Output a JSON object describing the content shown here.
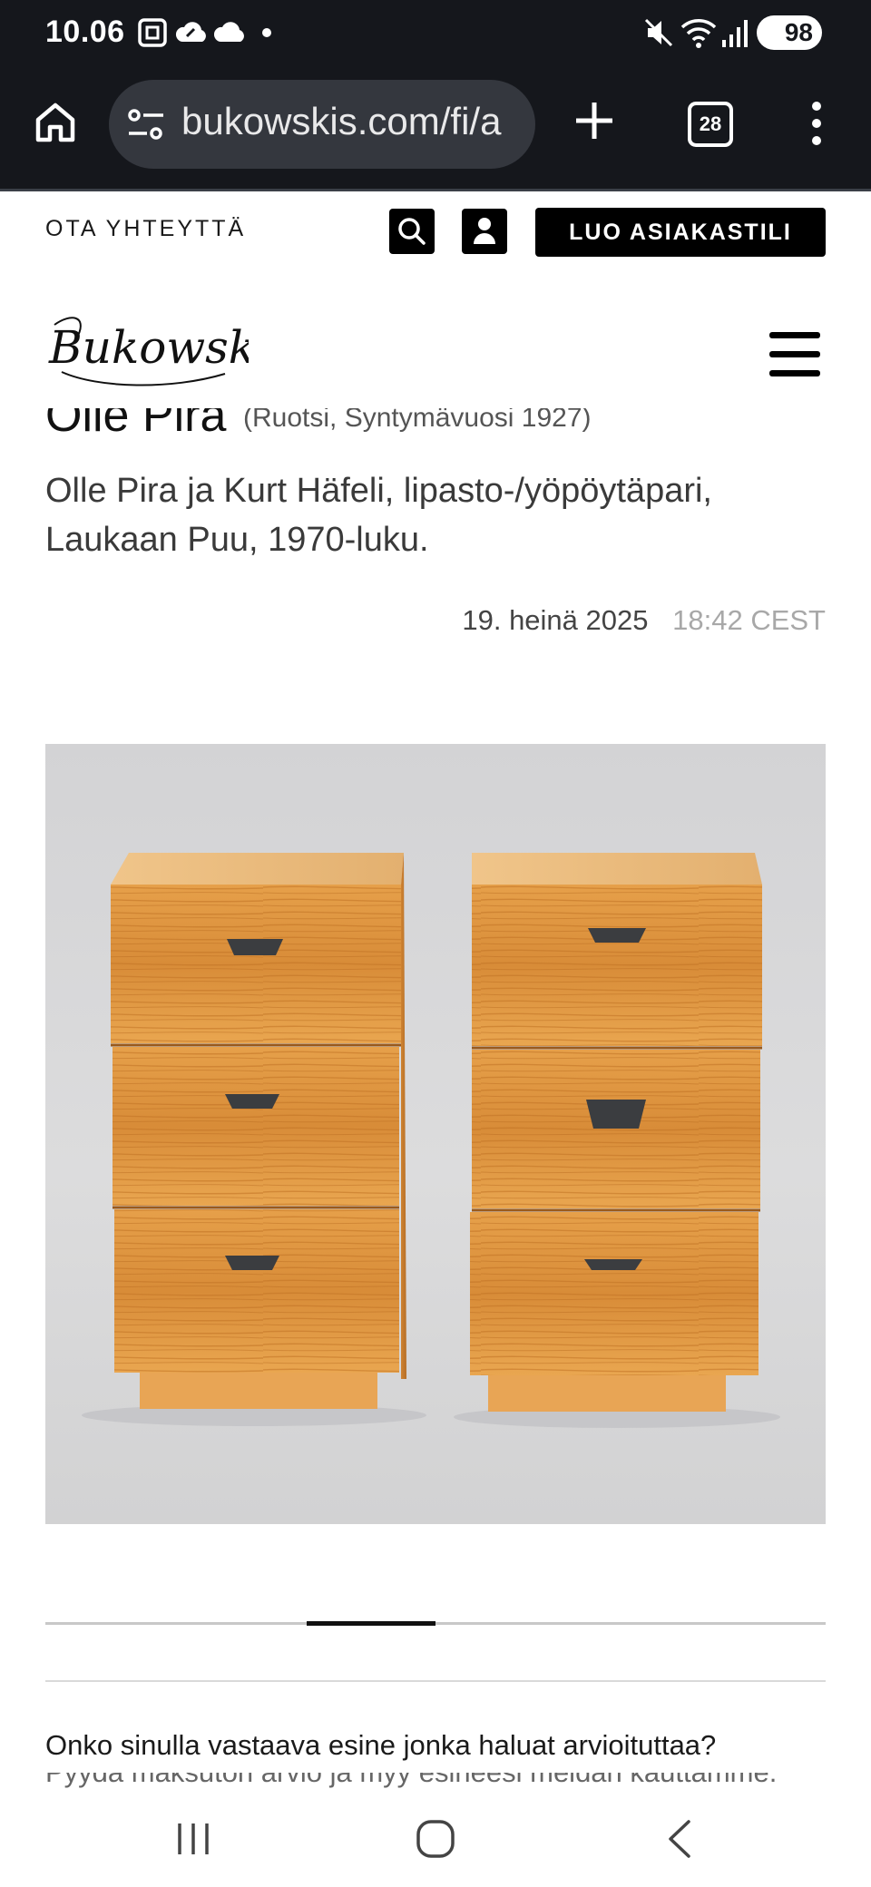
{
  "status_bar": {
    "time": "10.06",
    "battery": "98",
    "icons": [
      "screenshot-icon",
      "cloud-sync-icon",
      "cloud-icon",
      "dot-icon",
      "mute-icon",
      "wifi-icon",
      "signal-icon",
      "battery-icon"
    ]
  },
  "browser": {
    "url": "bukowskis.com/fi/a",
    "tab_count": "28",
    "icons": [
      "home-icon",
      "site-settings-icon",
      "new-tab-icon",
      "tabs-icon",
      "more-icon"
    ]
  },
  "header": {
    "contact_label": "OTA YHTEYTTÄ",
    "create_account_label": "LUO ASIAKASTILI",
    "icons": [
      "search-icon",
      "user-icon",
      "menu-icon"
    ],
    "logo_text": "Bukowskis"
  },
  "lot": {
    "artist_name": "Olle Pira",
    "artist_meta": "(Ruotsi, Syntymävuosi 1927)",
    "title": "Olle Pira ja Kurt Häfeli, lipasto-/yöpöytäpari, Laukaan Puu, 1970-luku.",
    "date": "19. heinä 2025",
    "time": "18:42 CEST"
  },
  "carousel": {
    "active_start": 0.335,
    "active_end": 0.5
  },
  "valuation": {
    "question": "Onko sinulla vastaava esine jonka haluat arvioituttaa?",
    "subtext": "Pyydä maksuton arvio ja myy esineesi meidän kauttamme."
  },
  "nav_bar": {
    "icons": [
      "recents-icon",
      "home-nav-icon",
      "back-icon"
    ]
  },
  "colors": {
    "status_bg": "#15171c",
    "accent": "#000000",
    "wood": "#d98f3a"
  }
}
